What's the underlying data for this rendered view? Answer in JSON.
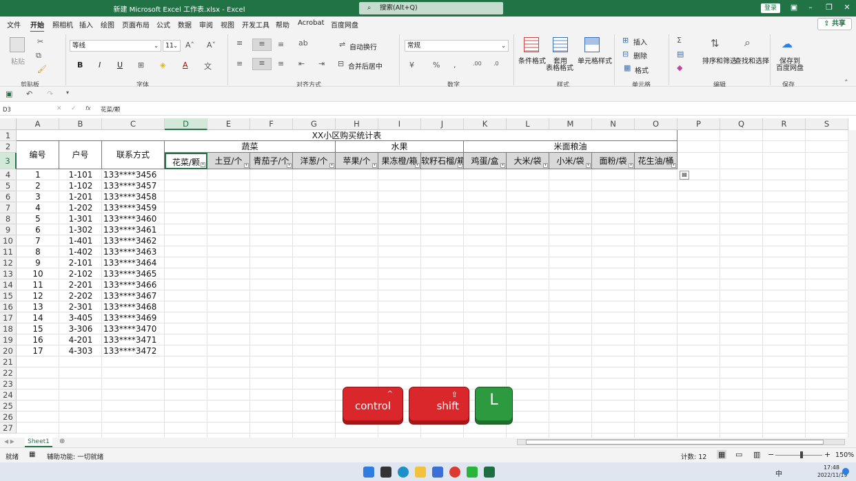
{
  "titlebar": {
    "title": "新建 Microsoft Excel 工作表.xlsx  -  Excel",
    "search": "搜索(Alt+Q)",
    "login": "登录"
  },
  "menu": {
    "items": [
      "文件",
      "开始",
      "插入",
      "绘图",
      "页面布局",
      "公式",
      "数据",
      "审阅",
      "视图",
      "开发工具",
      "帮助",
      "Acrobat",
      "百度网盘"
    ],
    "share": "共享"
  },
  "ribbon": {
    "paste": "粘贴",
    "font_name": "等线",
    "font_size": "11",
    "wrap": "自动换行",
    "merge": "合并后居中",
    "number_format": "常规",
    "cond_format": "条件格式",
    "table_format_1": "套用",
    "table_format_2": "表格格式",
    "cell_style": "单元格样式",
    "insert": "插入",
    "delete": "删除",
    "format": "格式",
    "sort_filter": "排序和筛选",
    "find_select": "查找和选择",
    "save_baidu_1": "保存到",
    "save_baidu_2": "百度网盘",
    "groups": {
      "clipboard": "剪贴板",
      "font": "字体",
      "alignment": "对齐方式",
      "number": "数字",
      "styles": "样式",
      "cells": "单元格",
      "editing": "编辑",
      "save": "保存"
    }
  },
  "formula_bar": {
    "namebox": "D3",
    "fx": "fx",
    "content": "花菜/颗"
  },
  "columns": [
    "A",
    "B",
    "C",
    "D",
    "E",
    "F",
    "G",
    "H",
    "I",
    "J",
    "K",
    "L",
    "M",
    "N",
    "O",
    "P",
    "Q",
    "R",
    "S"
  ],
  "rows": [
    "1",
    "2",
    "3",
    "4",
    "5",
    "6",
    "7",
    "8",
    "9",
    "10",
    "11",
    "12",
    "13",
    "14",
    "15",
    "16",
    "17",
    "18",
    "19",
    "20",
    "21",
    "22",
    "23",
    "24",
    "25",
    "26",
    "27"
  ],
  "sheet": {
    "title": "XX小区购买统计表",
    "header_no": "编号",
    "header_room": "户号",
    "header_contact": "联系方式",
    "cat_veg": "蔬菜",
    "cat_fruit": "水果",
    "cat_grain": "米面粮油",
    "sub": [
      "花菜/颗",
      "土豆/个",
      "青茄子/个",
      "洋葱/个",
      "苹果/个",
      "果冻橙/箱",
      "软籽石榴/箱",
      "鸡蛋/盒",
      "大米/袋",
      "小米/袋",
      "面粉/袋",
      "花生油/桶"
    ],
    "data": [
      [
        "1",
        "1-101",
        "133****3456"
      ],
      [
        "2",
        "1-102",
        "133****3457"
      ],
      [
        "3",
        "1-201",
        "133****3458"
      ],
      [
        "4",
        "1-202",
        "133****3459"
      ],
      [
        "5",
        "1-301",
        "133****3460"
      ],
      [
        "6",
        "1-302",
        "133****3461"
      ],
      [
        "7",
        "1-401",
        "133****3462"
      ],
      [
        "8",
        "1-402",
        "133****3463"
      ],
      [
        "9",
        "2-101",
        "133****3464"
      ],
      [
        "10",
        "2-102",
        "133****3465"
      ],
      [
        "11",
        "2-201",
        "133****3466"
      ],
      [
        "12",
        "2-202",
        "133****3467"
      ],
      [
        "13",
        "2-301",
        "133****3468"
      ],
      [
        "14",
        "3-405",
        "133****3469"
      ],
      [
        "15",
        "3-306",
        "133****3470"
      ],
      [
        "16",
        "4-201",
        "133****3471"
      ],
      [
        "17",
        "4-303",
        "133****3472"
      ]
    ]
  },
  "keys": {
    "k1": "control",
    "k2": "shift",
    "k3": "L"
  },
  "sheet_tab": "Sheet1",
  "status": {
    "ready": "就绪",
    "accessibility": "辅助功能: 一切就绪",
    "count": "计数: 12",
    "zoom": "150%"
  },
  "taskbar": {
    "time": "17:48",
    "date": "2022/11/19",
    "ime": "中"
  }
}
